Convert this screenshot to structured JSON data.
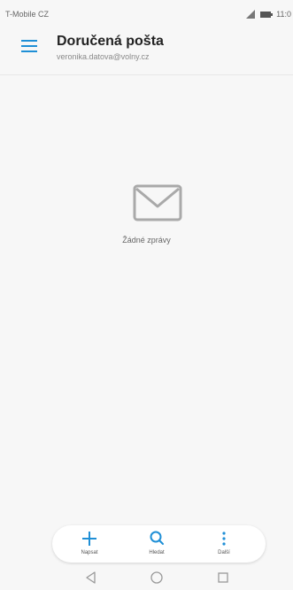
{
  "status_bar": {
    "carrier": "T-Mobile CZ",
    "time": "11:0",
    "signal_icon": "signal-icon",
    "battery_icon": "battery-icon"
  },
  "header": {
    "menu_icon": "hamburger-menu-icon",
    "title": "Doručená pošta",
    "subtitle": "veronika.datova@volny.cz"
  },
  "empty_state": {
    "icon": "envelope-icon",
    "message": "Žádné zprávy"
  },
  "action_bar": {
    "accent_color": "#1f8fd6",
    "actions": [
      {
        "icon": "plus-icon",
        "label": "Napsat"
      },
      {
        "icon": "search-icon",
        "label": "Hledat"
      },
      {
        "icon": "more-vertical-icon",
        "label": "Další"
      }
    ]
  },
  "nav_bar": {
    "back_icon": "back-triangle-icon",
    "home_icon": "home-circle-icon",
    "recent_icon": "recent-square-icon"
  }
}
